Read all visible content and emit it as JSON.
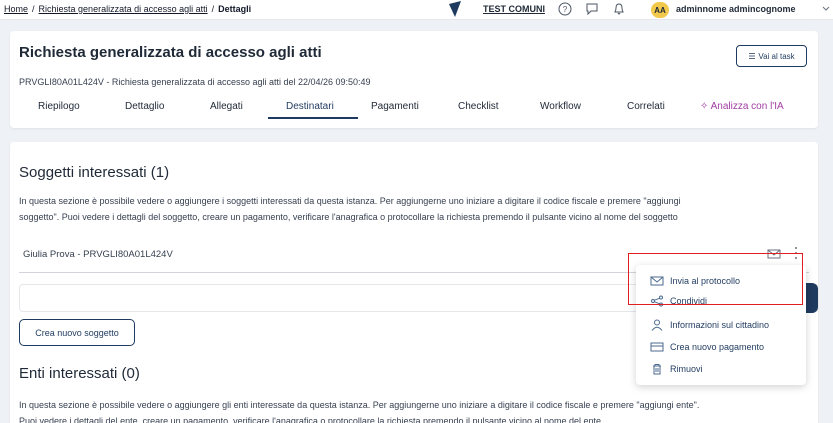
{
  "breadcrumb": {
    "items": [
      "Home",
      "Richiesta generalizzata di accesso agli atti"
    ],
    "separator": "/",
    "current": "Dettagli"
  },
  "topbar": {
    "org_name": "TEST COMUNI",
    "avatar_initials": "AA",
    "user_name": "adminnome admincognome"
  },
  "header": {
    "title": "Richiesta generalizzata di accesso agli atti",
    "task_button": "Vai al task",
    "subtitle": "PRVGLI80A01L424V - Richiesta generalizzata di accesso agli atti del 22/04/26 09:50:49",
    "tabs": [
      {
        "label": "Riepilogo"
      },
      {
        "label": "Dettaglio"
      },
      {
        "label": "Allegati"
      },
      {
        "label": "Destinatari"
      },
      {
        "label": "Pagamenti"
      },
      {
        "label": "Checklist"
      },
      {
        "label": "Workflow"
      },
      {
        "label": "Correlati"
      },
      {
        "label": "Analizza con l'IA"
      }
    ],
    "active_tab": "Destinatari"
  },
  "soggetti": {
    "title": "Soggetti interessati (1)",
    "description_line1": "In questa sezione è possibile vedere o aggiungere i soggetti interessati da questa istanza. Per aggiungerne uno iniziare a digitare il codice fiscale e premere \"aggiungi",
    "description_line2": "soggetto\". Puoi vedere i dettagli del soggetto, creare un pagamento, verificare l'anagrafica o protocollare la richiesta premendo il pulsante vicino al nome del soggetto",
    "subject_name": "Giulia Prova - PRVGLI80A01L424V",
    "new_button": "Crea nuovo soggetto"
  },
  "enti": {
    "title": "Enti interessati (0)",
    "description_line1": "In questa sezione è possibile vedere o aggiungere gli enti interessate da questa istanza. Per aggiungerne uno iniziare a digitare il codice fiscale e premere \"aggiungi ente\".",
    "description_line2": "Puoi vedere i dettagli del ente, creare un pagamento, verificare l'anagrafica o protocollare la richiesta premendo il pulsante vicino al nome del ente"
  },
  "dropdown": {
    "items": [
      {
        "label": "Invia al protocollo",
        "icon": "mail-icon"
      },
      {
        "label": "Condividi",
        "icon": "share-icon"
      },
      {
        "label": "Informazioni sul cittadino",
        "icon": "person-icon"
      },
      {
        "label": "Crea nuovo pagamento",
        "icon": "credit-card-icon"
      },
      {
        "label": "Rimuovi",
        "icon": "trash-icon"
      }
    ]
  },
  "colors": {
    "primary": "#1f3a5f",
    "ai_accent": "#a23ca2",
    "highlight_box": "#e02020",
    "avatar_bg": "#f2c94c"
  }
}
